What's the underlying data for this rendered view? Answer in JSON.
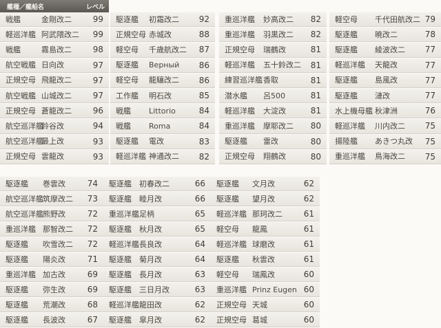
{
  "header": {
    "type_name": "艦種／艦船名",
    "level": "レベル"
  },
  "top_columns": [
    [
      {
        "type": "戦艦",
        "name": "金剛改二",
        "level": "99"
      },
      {
        "type": "軽巡洋艦",
        "name": "阿武隈改二",
        "level": "99"
      },
      {
        "type": "戦艦",
        "name": "霧島改二",
        "level": "98"
      },
      {
        "type": "航空戦艦",
        "name": "日向改",
        "level": "97"
      },
      {
        "type": "正規空母",
        "name": "飛龍改二",
        "level": "97"
      },
      {
        "type": "航空戦艦",
        "name": "山城改二",
        "level": "97"
      },
      {
        "type": "正規空母",
        "name": "蒼龍改二",
        "level": "96"
      },
      {
        "type": "航空巡洋艦",
        "name": "鈴谷改",
        "level": "94"
      },
      {
        "type": "航空巡洋艦",
        "name": "最上改",
        "level": "93"
      },
      {
        "type": "正規空母",
        "name": "雲龍改",
        "level": "93"
      }
    ],
    [
      {
        "type": "駆逐艦",
        "name": "初霜改二",
        "level": "92"
      },
      {
        "type": "正規空母",
        "name": "赤城改",
        "level": "88"
      },
      {
        "type": "軽空母",
        "name": "千歳航改二",
        "level": "87"
      },
      {
        "type": "駆逐艦",
        "name": "Верный",
        "level": "86"
      },
      {
        "type": "軽空母",
        "name": "龍驤改二",
        "level": "86"
      },
      {
        "type": "工作艦",
        "name": "明石改",
        "level": "85"
      },
      {
        "type": "戦艦",
        "name": "Littorio",
        "level": "84"
      },
      {
        "type": "戦艦",
        "name": "Roma",
        "level": "84"
      },
      {
        "type": "駆逐艦",
        "name": "電改",
        "level": "83"
      },
      {
        "type": "軽巡洋艦",
        "name": "神通改二",
        "level": "82"
      }
    ],
    [
      {
        "type": "重巡洋艦",
        "name": "妙高改二",
        "level": "82"
      },
      {
        "type": "重巡洋艦",
        "name": "羽黒改二",
        "level": "82"
      },
      {
        "type": "正規空母",
        "name": "瑞鶴改",
        "level": "81"
      },
      {
        "type": "軽巡洋艦",
        "name": "五十鈴改二",
        "level": "81"
      },
      {
        "type": "練習巡洋艦",
        "name": "香取",
        "level": "81"
      },
      {
        "type": "潜水艦",
        "name": "呂500",
        "level": "81"
      },
      {
        "type": "軽巡洋艦",
        "name": "大淀改",
        "level": "81"
      },
      {
        "type": "重巡洋艦",
        "name": "摩耶改二",
        "level": "80"
      },
      {
        "type": "駆逐艦",
        "name": "雷改",
        "level": "80"
      },
      {
        "type": "正規空母",
        "name": "翔鶴改",
        "level": "80"
      }
    ],
    [
      {
        "type": "軽空母",
        "name": "千代田航改二",
        "level": "79"
      },
      {
        "type": "駆逐艦",
        "name": "暁改二",
        "level": "78"
      },
      {
        "type": "駆逐艦",
        "name": "綾波改二",
        "level": "77"
      },
      {
        "type": "軽巡洋艦",
        "name": "天龍改",
        "level": "77"
      },
      {
        "type": "駆逐艦",
        "name": "島風改",
        "level": "77"
      },
      {
        "type": "駆逐艦",
        "name": "漣改",
        "level": "77"
      },
      {
        "type": "水上機母艦",
        "name": "秋津洲",
        "level": "76"
      },
      {
        "type": "軽巡洋艦",
        "name": "川内改二",
        "level": "75"
      },
      {
        "type": "揚陸艦",
        "name": "あきつ丸改",
        "level": "75"
      },
      {
        "type": "重巡洋艦",
        "name": "鳥海改二",
        "level": "75"
      }
    ]
  ],
  "bottom_columns": [
    [
      {
        "type": "駆逐艦",
        "name": "巻雲改",
        "level": "74"
      },
      {
        "type": "航空巡洋艦",
        "name": "筑摩改二",
        "level": "73"
      },
      {
        "type": "航空巡洋艦",
        "name": "熊野改",
        "level": "72"
      },
      {
        "type": "重巡洋艦",
        "name": "那智改二",
        "level": "72"
      },
      {
        "type": "駆逐艦",
        "name": "吹雪改二",
        "level": "72"
      },
      {
        "type": "駆逐艦",
        "name": "陽炎改",
        "level": "71"
      },
      {
        "type": "重巡洋艦",
        "name": "加古改",
        "level": "69"
      },
      {
        "type": "駆逐艦",
        "name": "弥生改",
        "level": "69"
      },
      {
        "type": "駆逐艦",
        "name": "荒潮改",
        "level": "68"
      },
      {
        "type": "駆逐艦",
        "name": "長波改",
        "level": "67"
      }
    ],
    [
      {
        "type": "駆逐艦",
        "name": "初春改二",
        "level": "66"
      },
      {
        "type": "駆逐艦",
        "name": "睦月改",
        "level": "66"
      },
      {
        "type": "重巡洋艦",
        "name": "足柄",
        "level": "65"
      },
      {
        "type": "駆逐艦",
        "name": "秋月改",
        "level": "65"
      },
      {
        "type": "軽巡洋艦",
        "name": "長良改",
        "level": "64"
      },
      {
        "type": "駆逐艦",
        "name": "菊月改",
        "level": "64"
      },
      {
        "type": "駆逐艦",
        "name": "長月改",
        "level": "63"
      },
      {
        "type": "駆逐艦",
        "name": "三日月改",
        "level": "63"
      },
      {
        "type": "軽巡洋艦",
        "name": "龍田改",
        "level": "62"
      },
      {
        "type": "駆逐艦",
        "name": "皐月改",
        "level": "62"
      }
    ],
    [
      {
        "type": "駆逐艦",
        "name": "文月改",
        "level": "62"
      },
      {
        "type": "駆逐艦",
        "name": "望月改",
        "level": "62"
      },
      {
        "type": "軽巡洋艦",
        "name": "那珂改二",
        "level": "61"
      },
      {
        "type": "軽空母",
        "name": "龍鳳",
        "level": "61"
      },
      {
        "type": "軽巡洋艦",
        "name": "球磨改",
        "level": "61"
      },
      {
        "type": "駆逐艦",
        "name": "秋雲改",
        "level": "61"
      },
      {
        "type": "軽空母",
        "name": "瑞鳳改",
        "level": "60"
      },
      {
        "type": "重巡洋艦",
        "name": "Prinz Eugen",
        "level": "60"
      },
      {
        "type": "正規空母",
        "name": "天城",
        "level": "60"
      },
      {
        "type": "正規空母",
        "name": "葛城",
        "level": "60"
      }
    ]
  ]
}
